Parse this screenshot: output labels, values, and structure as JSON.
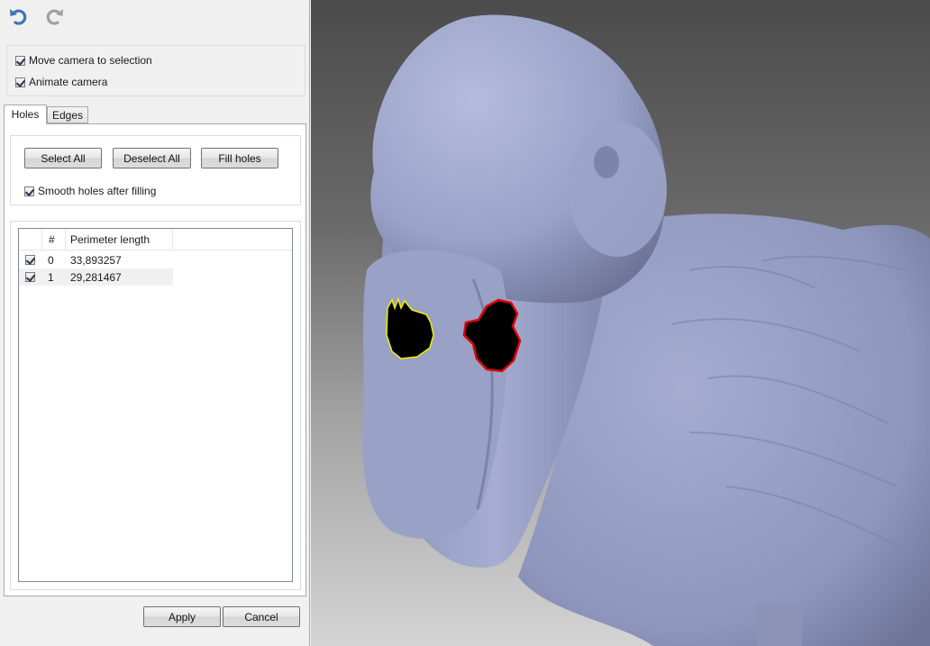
{
  "toolbar": {
    "undo_icon": "undo-icon",
    "redo_icon": "redo-icon"
  },
  "options": {
    "move_camera_label": "Move camera to selection",
    "move_camera_checked": true,
    "animate_camera_label": "Animate camera",
    "animate_camera_checked": true
  },
  "tabs": [
    {
      "label": "Holes",
      "active": true
    },
    {
      "label": "Edges",
      "active": false
    }
  ],
  "holes": {
    "select_all_label": "Select All",
    "deselect_all_label": "Deselect All",
    "fill_holes_label": "Fill holes",
    "smooth_label": "Smooth holes after filling",
    "smooth_checked": true,
    "table": {
      "columns": [
        "#",
        "Perimeter length"
      ],
      "rows": [
        {
          "index": "0",
          "length": "33,893257",
          "checked": true
        },
        {
          "index": "1",
          "length": "29,281467",
          "checked": true
        }
      ]
    }
  },
  "footer": {
    "apply_label": "Apply",
    "cancel_label": "Cancel"
  },
  "viewport": {
    "model": "3D duck mesh",
    "mesh_color": "#9aa2c8",
    "hole_outline_colors": [
      "#f0f000",
      "#e00000"
    ]
  }
}
